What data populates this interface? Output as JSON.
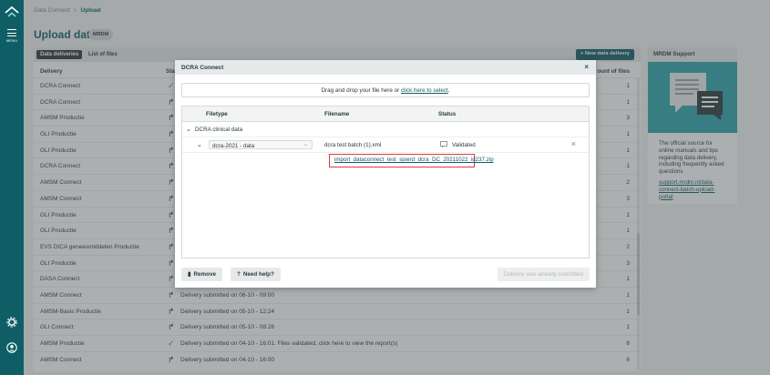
{
  "rail": {
    "menu_label": "MENU"
  },
  "breadcrumb": {
    "root": "Data Connect",
    "separator": ">",
    "current": "Upload"
  },
  "page": {
    "title": "Upload data",
    "badge": "MRDM"
  },
  "tabs": {
    "deliveries": "Data deliveries",
    "files": "List of files"
  },
  "new_delivery_label": "+ New data delivery",
  "table": {
    "headers": {
      "delivery": "Delivery",
      "status": "Sta",
      "count": "ount of files"
    },
    "rows": [
      {
        "delivery": "DCRA Connect",
        "status": "ok",
        "text": "",
        "count": "1"
      },
      {
        "delivery": "DCRA Connect",
        "status": "up",
        "text": "",
        "count": "1"
      },
      {
        "delivery": "AMSM Productie",
        "status": "up",
        "text": "",
        "count": "3"
      },
      {
        "delivery": "GLI Productie",
        "status": "up",
        "text": "",
        "count": "1"
      },
      {
        "delivery": "GLI Productie",
        "status": "up",
        "text": "",
        "count": "1"
      },
      {
        "delivery": "DCRA Connect",
        "status": "up",
        "text": "",
        "count": "1"
      },
      {
        "delivery": "AMSM Connect",
        "status": "up",
        "text": "",
        "count": "2"
      },
      {
        "delivery": "AMSM Connect",
        "status": "up",
        "text": "",
        "count": "3"
      },
      {
        "delivery": "GLI Productie",
        "status": "up",
        "text": "",
        "count": "1"
      },
      {
        "delivery": "GLI Productie",
        "status": "up",
        "text": "",
        "count": "1"
      },
      {
        "delivery": "EVS DICA geneesmiddelen Productie",
        "status": "up",
        "text": "",
        "count": "2"
      },
      {
        "delivery": "GLI Productie",
        "status": "up",
        "text": "",
        "count": "3"
      },
      {
        "delivery": "DASA Connect",
        "status": "up",
        "text": "",
        "count": "1"
      },
      {
        "delivery": "AMSM Connect",
        "status": "up",
        "text": "Delivery submitted on 06-10 - 09:00",
        "count": "1"
      },
      {
        "delivery": "AMSM-Basis Productie",
        "status": "up",
        "text": "Delivery submitted on 05-10 - 12:24",
        "count": "1"
      },
      {
        "delivery": "GLI Connect",
        "status": "up",
        "text": "Delivery submitted on 05-10 - 08:28",
        "count": "1"
      },
      {
        "delivery": "AMSM Productie",
        "status": "ok",
        "text": "Delivery submitted on 04-10 - 16:01. Files validated, click here to view the report(s)",
        "count": "6"
      },
      {
        "delivery": "AMSM Connect",
        "status": "up",
        "text": "Delivery submitted on 04-10 - 16:00",
        "count": "6"
      }
    ]
  },
  "support": {
    "title": "MRDM Support",
    "text": "The official source for online manuals and tips regarding data delivery, including frequently asked questions",
    "link": "support.mrdm.nl/data-connect-batch-upload-portal"
  },
  "modal": {
    "title": "DCRA Connect",
    "close": "×",
    "drop_text": "Drag and drop your file here or ",
    "drop_link": "click here to select",
    "drop_end": ".",
    "headers": {
      "filetype": "Filetype",
      "filename": "Filename",
      "status": "Status"
    },
    "group": "DCRA clinical data",
    "file": {
      "type": "dcra-2021 - data",
      "name": "dcra test batch (1).xml",
      "status": "Validated",
      "remove": "×"
    },
    "zip_link": "import_dataconnect_test_sjoerd_dcra_DC_20211022_id237.zip",
    "buttons": {
      "remove": "Remove",
      "help": "Need help?",
      "submit": "Delivery was already submitted"
    }
  }
}
